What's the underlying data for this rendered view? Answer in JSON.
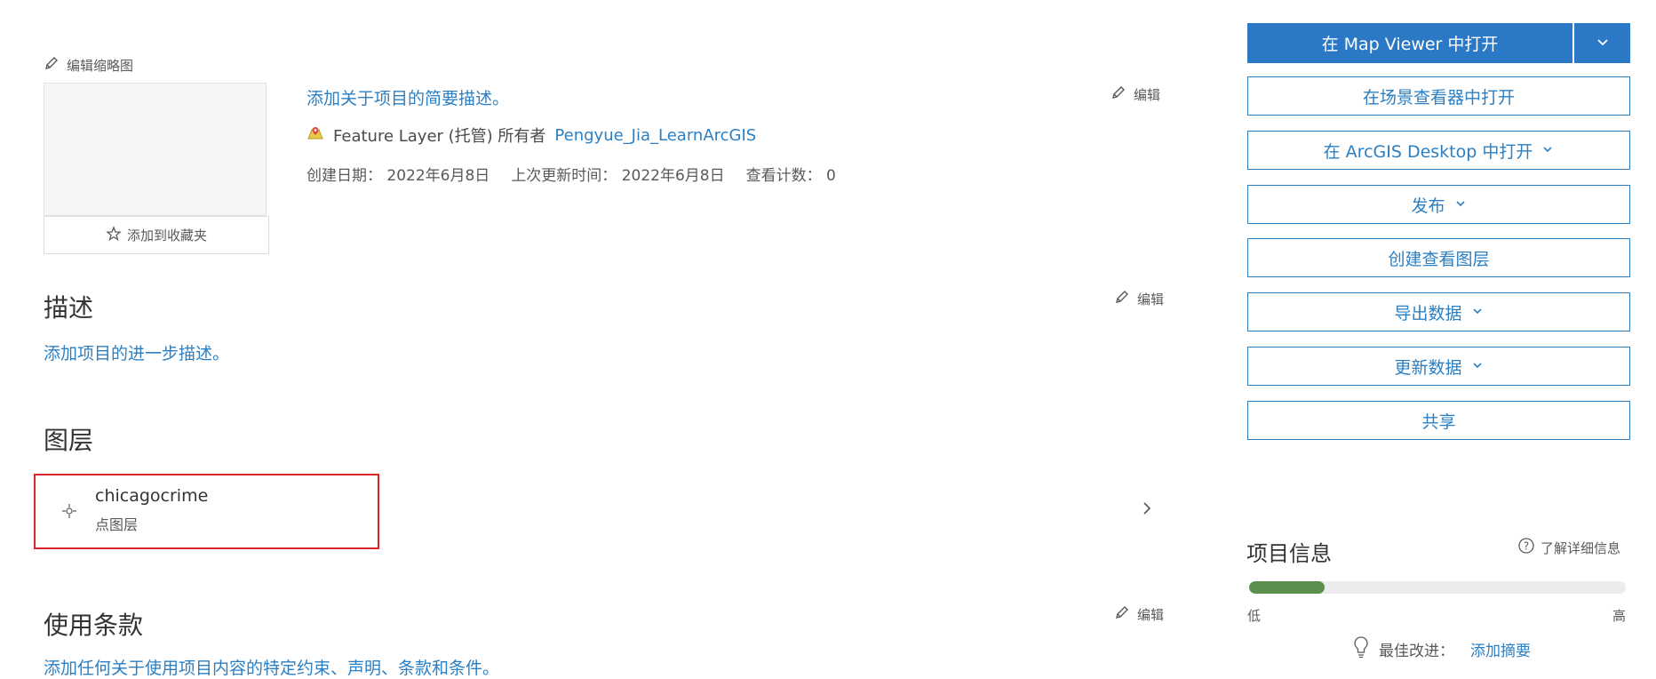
{
  "thumbnail": {
    "edit_label": "编辑缩略图",
    "favorite_label": "添加到收藏夹"
  },
  "summary": {
    "add_summary": "添加关于项目的简要描述。",
    "edit_label": "编辑",
    "type_text": "Feature Layer (托管) 所有者",
    "owner": "Pengyue_Jia_LearnArcGIS",
    "created": "创建日期： 2022年6月8日",
    "updated": "上次更新时间： 2022年6月8日",
    "views": "查看计数： 0"
  },
  "description": {
    "title": "描述",
    "edit_label": "编辑",
    "add_text": "添加项目的进一步描述。"
  },
  "layers": {
    "title": "图层",
    "items": [
      {
        "name": "chicagocrime",
        "type": "点图层"
      }
    ]
  },
  "terms": {
    "title": "使用条款",
    "edit_label": "编辑",
    "add_text": "添加任何关于使用项目内容的特定约束、声明、条款和条件。"
  },
  "actions": {
    "open_map_viewer": "在 Map Viewer 中打开",
    "open_scene_viewer": "在场景查看器中打开",
    "open_desktop": "在 ArcGIS Desktop 中打开",
    "publish": "发布",
    "create_view_layer": "创建查看图层",
    "export_data": "导出数据",
    "update_data": "更新数据",
    "share": "共享"
  },
  "item_info": {
    "title": "项目信息",
    "learn_more": "了解详细信息",
    "progress_fraction": 0.2,
    "low_label": "低",
    "high_label": "高",
    "best_improve_label": "最佳改进：",
    "best_improve_link": "添加摘要"
  },
  "colors": {
    "accent": "#2b7fc2",
    "progress": "#5a8f4e",
    "highlight": "#d9262a"
  }
}
